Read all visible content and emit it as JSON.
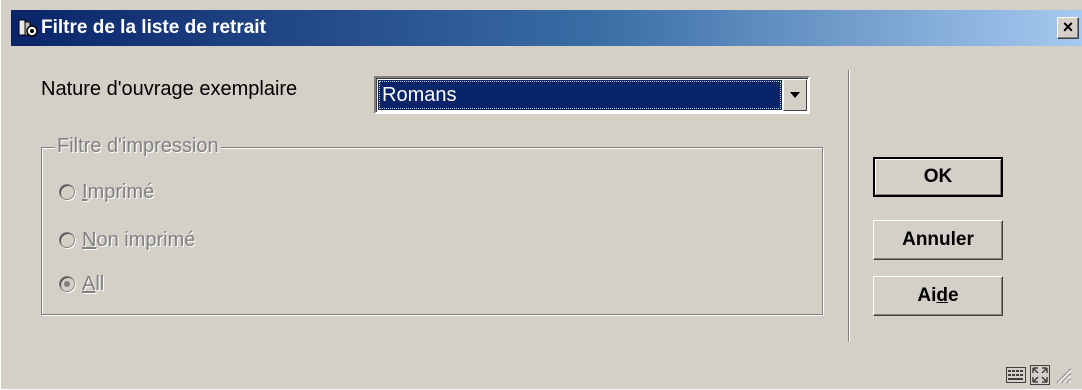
{
  "window": {
    "title": "Filtre de la liste de retrait",
    "close_label": "×"
  },
  "form": {
    "nature_label": "Nature d'ouvrage exemplaire",
    "nature_value": "Romans",
    "group_title": "Filtre d'impression",
    "radios": [
      {
        "prefix": "",
        "accel": "I",
        "suffix": "mprimé",
        "checked": false
      },
      {
        "prefix": "",
        "accel": "N",
        "suffix": "on imprimé",
        "checked": false
      },
      {
        "prefix": "",
        "accel": "A",
        "suffix": "ll",
        "checked": true
      }
    ]
  },
  "buttons": {
    "ok": "OK",
    "cancel": "Annuler",
    "help_prefix": "Ai",
    "help_accel": "d",
    "help_suffix": "e"
  },
  "colors": {
    "titlebar_start": "#0a246a",
    "titlebar_end": "#a6caf0",
    "face": "#d4d0c8",
    "selection": "#0a246a"
  }
}
